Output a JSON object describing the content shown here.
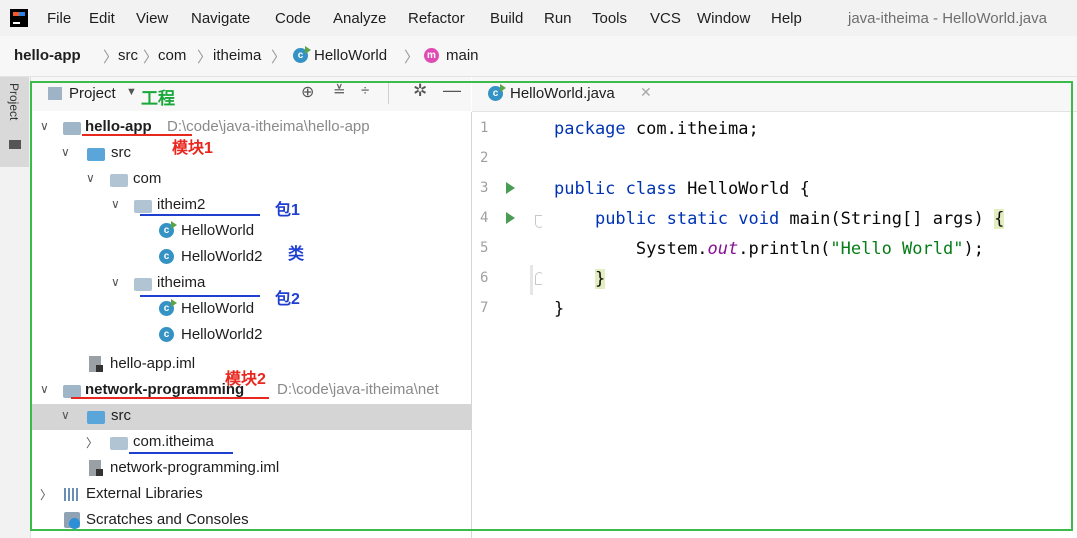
{
  "menu": {
    "items": [
      "File",
      "Edit",
      "View",
      "Navigate",
      "Code",
      "Analyze",
      "Refactor",
      "Build",
      "Run",
      "Tools",
      "VCS",
      "Window",
      "Help"
    ],
    "window_title": "java-itheima - HelloWorld.java"
  },
  "breadcrumb": [
    "hello-app",
    "src",
    "com",
    "itheima",
    "HelloWorld",
    "main"
  ],
  "stripe": {
    "project_tab": "Project"
  },
  "project_panel": {
    "title": "Project",
    "annotation": "工程",
    "tree": {
      "module1": {
        "name": "hello-app",
        "path": "D:\\code\\java-itheima\\hello-app",
        "annotation": "模块1"
      },
      "src1": "src",
      "com": "com",
      "itheim2": {
        "name": "itheim2",
        "annotation": "包1"
      },
      "class_a1": "HelloWorld",
      "class_a2": "HelloWorld2",
      "class_annotation": "类",
      "itheima": {
        "name": "itheima",
        "annotation": "包2"
      },
      "class_b1": "HelloWorld",
      "class_b2": "HelloWorld2",
      "iml1": "hello-app.iml",
      "module2": {
        "name": "network-programming",
        "path": "D:\\code\\java-itheima\\net",
        "annotation": "模块2"
      },
      "src2": "src",
      "com_itheima": "com.itheima",
      "iml2": "network-programming.iml",
      "external_libraries": "External Libraries",
      "scratches": "Scratches and Consoles"
    }
  },
  "editor": {
    "tab": "HelloWorld.java",
    "line_numbers": [
      "1",
      "2",
      "3",
      "4",
      "5",
      "6",
      "7"
    ],
    "code": {
      "l1_kw": "package",
      "l1_rest": " com.itheima;",
      "l3_kw": "public class",
      "l3_rest": " HelloWorld {",
      "l4_kw": "public static void",
      "l4_rest": " main(String[] args) ",
      "l4_brace": "{",
      "l5_a": "System.",
      "l5_out": "out",
      "l5_b": ".println(",
      "l5_str": "\"Hello World\"",
      "l5_c": ");",
      "l6": "}",
      "l7": "}"
    }
  },
  "colors": {
    "highlight_box": "#3cba4a",
    "annotation_red": "#e8271f",
    "annotation_blue": "#1f3fd0"
  }
}
